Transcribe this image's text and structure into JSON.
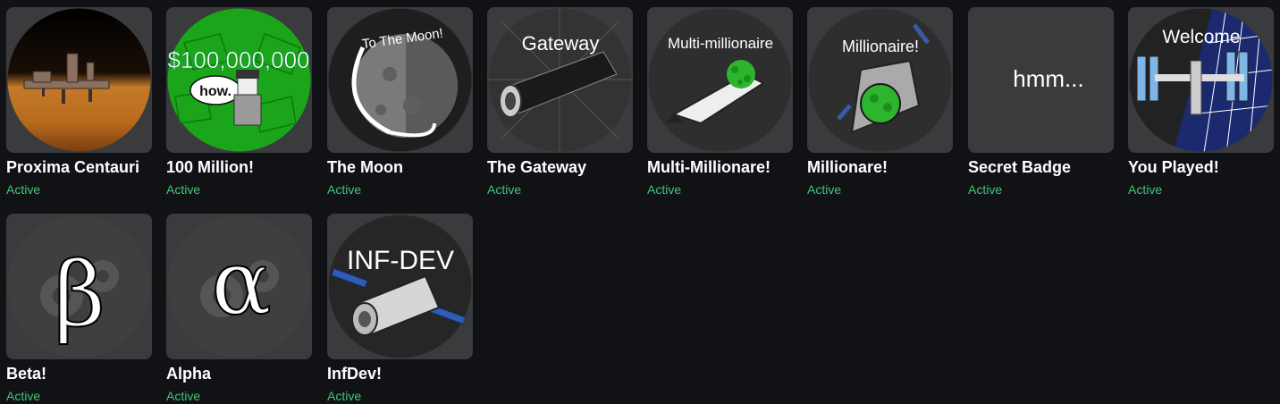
{
  "badges": [
    {
      "name": "Proxima Centauri",
      "status": "Active",
      "icon": "proxima-centauri-icon"
    },
    {
      "name": "100 Million!",
      "status": "Active",
      "icon": "money-stack-icon",
      "art_text": "$100,000,000",
      "bubble": "how."
    },
    {
      "name": "The Moon",
      "status": "Active",
      "icon": "moon-icon",
      "art_text": "To The Moon!"
    },
    {
      "name": "The Gateway",
      "status": "Active",
      "icon": "gateway-icon",
      "art_text": "Gateway"
    },
    {
      "name": "Multi-Millionare!",
      "status": "Active",
      "icon": "shuttle-icon",
      "art_text": "Multi-millionaire"
    },
    {
      "name": "Millionare!",
      "status": "Active",
      "icon": "capsule-icon",
      "art_text": "Millionaire!"
    },
    {
      "name": "Secret Badge",
      "status": "Active",
      "icon": "secret-icon",
      "art_text": "hmm..."
    },
    {
      "name": "You Played!",
      "status": "Active",
      "icon": "space-station-icon",
      "art_text": "Welcome"
    },
    {
      "name": "Beta!",
      "status": "Active",
      "icon": "beta-gear-icon",
      "art_text": "β"
    },
    {
      "name": "Alpha",
      "status": "Active",
      "icon": "alpha-gear-icon",
      "art_text": "α"
    },
    {
      "name": "InfDev!",
      "status": "Active",
      "icon": "satellite-icon",
      "art_text": "INF-DEV"
    }
  ],
  "colors": {
    "background": "#111216",
    "tile": "#393b3d",
    "active": "#3fc679",
    "text": "#ffffff"
  }
}
